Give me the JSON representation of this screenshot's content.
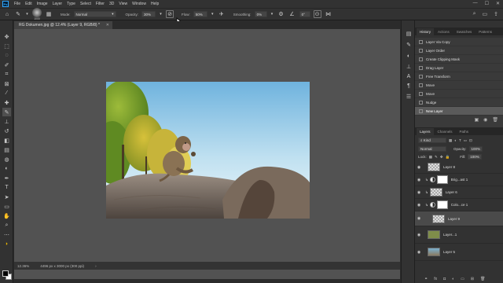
{
  "app": {
    "logo": "Ps"
  },
  "menu": [
    "File",
    "Edit",
    "Image",
    "Layer",
    "Type",
    "Select",
    "Filter",
    "3D",
    "View",
    "Window",
    "Help"
  ],
  "window_controls": [
    "—",
    "☐",
    "✕"
  ],
  "options": {
    "brush_size": "1000",
    "mode_label": "Mode:",
    "mode_value": "Normal",
    "opacity_label": "Opacity:",
    "opacity_value": "30%",
    "flow_label": "Flow:",
    "flow_value": "50%",
    "smoothing_label": "Smoothing:",
    "smoothing_value": "0%",
    "angle_value": "0°"
  },
  "document": {
    "tab_title": "RG Dokumen.jpg @ 12.4% (Layer 9, RGB/8) *",
    "zoom": "12.36%",
    "dimensions": "4496 px x 3000 px (300 ppi)"
  },
  "history": {
    "tabs": [
      "History",
      "Actions",
      "Swatches",
      "Patterns"
    ],
    "items": [
      "Layer Via Copy",
      "Layer Order",
      "Create Clipping Mask",
      "Drag Layer",
      "Free Transform",
      "Move",
      "Move",
      "Nudge",
      "New Layer"
    ],
    "selected_index": 8
  },
  "layers": {
    "tabs": [
      "Layers",
      "Channels",
      "Paths"
    ],
    "filter_label": "Kind",
    "blend_mode": "Normal",
    "opacity_label": "Opacity:",
    "opacity_value": "100%",
    "lock_label": "Lock:",
    "fill_label": "Fill:",
    "fill_value": "100%",
    "items": [
      {
        "name": "Layer 8",
        "type": "pixel"
      },
      {
        "name": "Brig...ast 1",
        "type": "adjustment"
      },
      {
        "name": "Layer 6",
        "type": "pixel"
      },
      {
        "name": "Colo...ce 1",
        "type": "adjustment"
      },
      {
        "name": "Layer 9",
        "type": "pixel",
        "selected": true
      },
      {
        "name": "Layer...1",
        "type": "pixel"
      },
      {
        "name": "Layer 5",
        "type": "pixel"
      }
    ]
  }
}
